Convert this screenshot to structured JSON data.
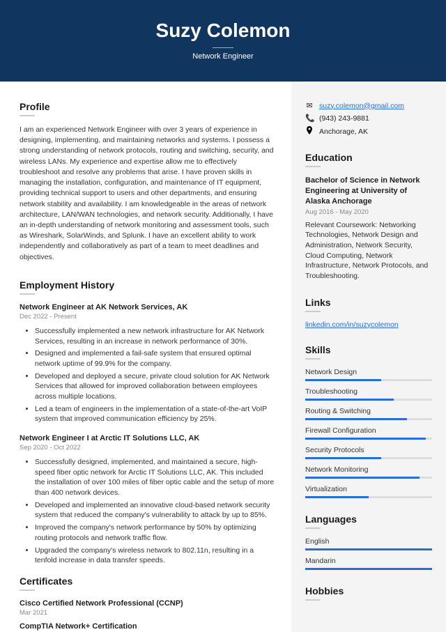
{
  "header": {
    "name": "Suzy Colemon",
    "title": "Network Engineer"
  },
  "profile": {
    "heading": "Profile",
    "text": "I am an experienced Network Engineer with over 3 years of experience in designing, implementing, and maintaining networks and systems. I possess a strong understanding of network protocols, routing and switching, security, and wireless LANs. My experience and expertise allow me to effectively troubleshoot and resolve any problems that arise. I have proven skills in managing the installation, configuration, and maintenance of IT equipment, providing technical support to users and other departments, and ensuring network stability and availability. I am knowledgeable in the areas of network architecture, LAN/WAN technologies, and network security. Additionally, I have an in-depth understanding of network monitoring and assessment tools, such as Wireshark, SolarWinds, and Splunk. I have an excellent ability to work independently and collaboratively as part of a team to meet deadlines and objectives."
  },
  "employment": {
    "heading": "Employment History",
    "jobs": [
      {
        "title": "Network Engineer at AK Network Services, AK",
        "dates": "Dec 2022 - Present",
        "bullets": [
          "Successfully implemented a new network infrastructure for AK Network Services, resulting in an increase in network performance of 30%.",
          "Designed and implemented a fail-safe system that ensured optimal network uptime of 99.9% for the company.",
          "Developed and deployed a secure, private cloud solution for AK Network Services that allowed for improved collaboration between employees across multiple locations.",
          "Led a team of engineers in the implementation of a state-of-the-art VoIP system that improved communication efficiency by 25%."
        ]
      },
      {
        "title": "Network Engineer I at Arctic IT Solutions LLC, AK",
        "dates": "Sep 2020 - Oct 2022",
        "bullets": [
          "Successfully designed, implemented, and maintained a secure, high-speed fiber optic network for Arctic IT Solutions LLC, AK. This included the installation of over 100 miles of fiber optic cable and the setup of more than 400 network devices.",
          "Developed and implemented an innovative cloud-based network security system that reduced the company's vulnerability to attack by up to 85%.",
          "Improved the company's network performance by 50% by optimizing routing protocols and network traffic flow.",
          "Upgraded the company's wireless network to 802.11n, resulting in a tenfold increase in data transfer speeds."
        ]
      }
    ]
  },
  "certificates": {
    "heading": "Certificates",
    "items": [
      {
        "title": "Cisco Certified Network Professional (CCNP)",
        "date": "Mar 2021"
      },
      {
        "title": "CompTIA Network+ Certification",
        "date": ""
      }
    ]
  },
  "contact": {
    "email": "suzy.colemon@gmail.com",
    "phone": "(943) 243-9881",
    "location": "Anchorage, AK"
  },
  "education": {
    "heading": "Education",
    "title": "Bachelor of Science in Network Engineering at University of Alaska Anchorage",
    "dates": "Aug 2016 - May 2020",
    "text": "Relevant Coursework: Networking Technologies, Network Design and Administration, Network Security, Cloud Computing, Network Infrastructure, Network Protocols, and Troubleshooting."
  },
  "links": {
    "heading": "Links",
    "url": "linkedin.com/in/suzycolemon"
  },
  "skills": {
    "heading": "Skills",
    "items": [
      {
        "name": "Network Design",
        "level": 60
      },
      {
        "name": "Troubleshooting",
        "level": 70
      },
      {
        "name": "Routing & Switching",
        "level": 80
      },
      {
        "name": "Firewall Configuration",
        "level": 95
      },
      {
        "name": "Security Protocols",
        "level": 60
      },
      {
        "name": "Network Monitoring",
        "level": 90
      },
      {
        "name": "Virtualization",
        "level": 50
      }
    ]
  },
  "languages": {
    "heading": "Languages",
    "items": [
      {
        "name": "English",
        "level": 100
      },
      {
        "name": "Mandarin",
        "level": 100
      }
    ]
  },
  "hobbies": {
    "heading": "Hobbies"
  }
}
